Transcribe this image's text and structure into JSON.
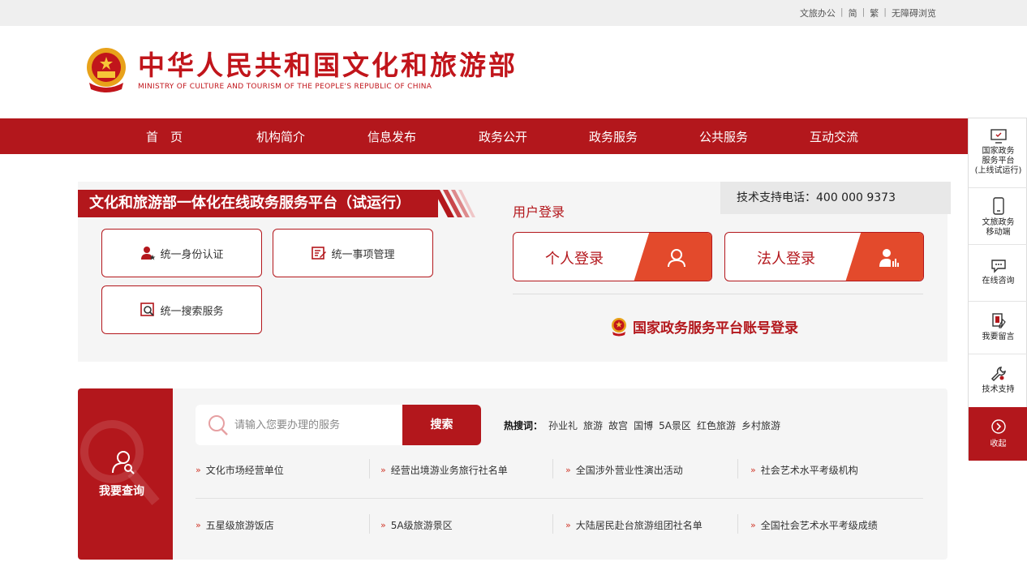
{
  "topbar": {
    "office": "文旅办公",
    "simplified": "简",
    "traditional": "繁",
    "accessible": "无障碍浏览",
    "sep": "|"
  },
  "logo": {
    "title": "中华人民共和国文化和旅游部",
    "subtitle": "MINISTRY OF CULTURE AND TOURISM OF THE PEOPLE'S REPUBLIC OF CHINA"
  },
  "nav": [
    "首　页",
    "机构简介",
    "信息发布",
    "政务公开",
    "政务服务",
    "公共服务",
    "互动交流"
  ],
  "platform": {
    "title": "文化和旅游部一体化在线政务服务平台（试运行）",
    "buttons": [
      "统一身份认证",
      "统一事项管理",
      "统一搜索服务"
    ]
  },
  "login": {
    "heading": "用户登录",
    "tel": "技术支持电话：400 000 9373",
    "personal": "个人登录",
    "legal": "法人登录",
    "gov": "国家政务服务平台账号登录"
  },
  "query": {
    "label": "我要查询",
    "placeholder": "请输入您要办理的服务",
    "search": "搜索",
    "hot_label": "热搜词：",
    "hot_words": [
      "孙业礼",
      "旅游",
      "故宫",
      "国博",
      "5A景区",
      "红色旅游",
      "乡村旅游"
    ],
    "links": [
      "文化市场经营单位",
      "经营出境游业务旅行社名单",
      "全国涉外营业性演出活动",
      "社会艺术水平考级机构",
      "五星级旅游饭店",
      "5A级旅游景区",
      "大陆居民赴台旅游组团社名单",
      "全国社会艺术水平考级成绩"
    ]
  },
  "sidebar": {
    "gov_platform_1": "国家政务",
    "gov_platform_2": "服务平台",
    "gov_platform_3": "(上线试运行)",
    "mobile_1": "文旅政务",
    "mobile_2": "移动端",
    "consult": "在线咨询",
    "message": "我要留言",
    "support": "技术支持",
    "collapse": "收起"
  },
  "colors": {
    "brand_red": "#b3171c",
    "accent_orange": "#e34a2c"
  }
}
